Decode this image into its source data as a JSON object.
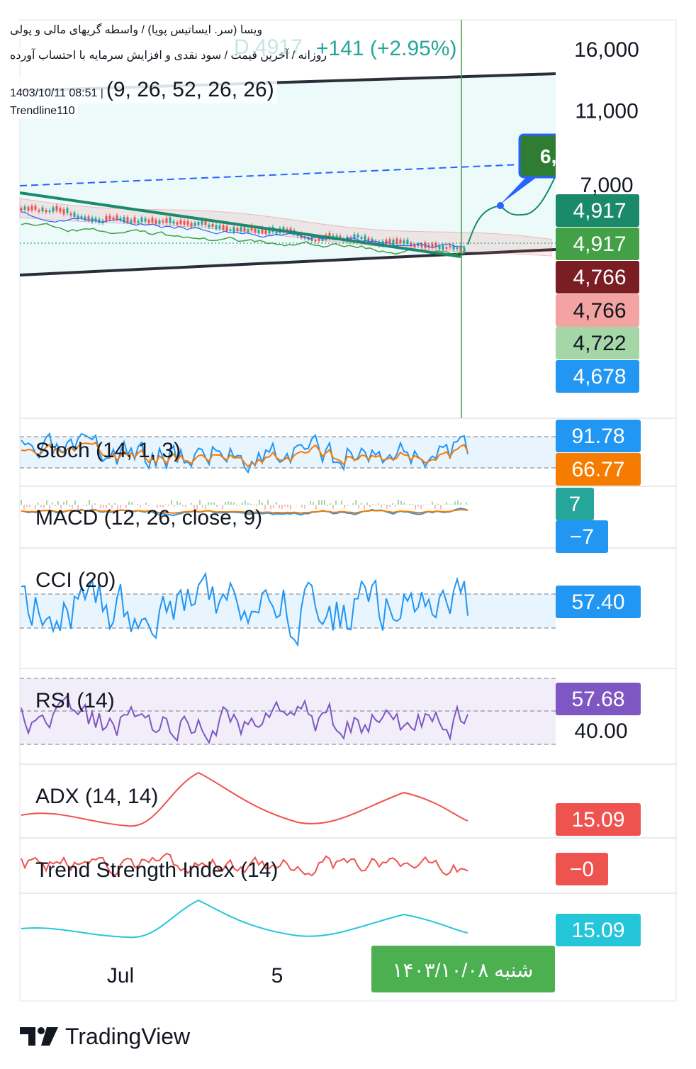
{
  "header": {
    "line1": "ویسا (سر. ایساتیس پویا) / واسطه گریهای مالی و پولی",
    "line2": "روزانه / آخرین قیمت / سود نقدی و افزایش سرمایه با احتساب آورده",
    "change": "+141 (+2.95%)",
    "ghost_price": "D 4917",
    "timestamp": "1403/10/11 08:51",
    "indicator_params": "(9, 26, 52, 26, 26)",
    "author": "Trendline110"
  },
  "colors": {
    "bull": "#26a69a",
    "bear": "#ef5350",
    "blue": "#2962ff",
    "orange": "#f57c00",
    "purple": "#7e57c2",
    "cyan": "#26c6da",
    "trend_green": "#1b8a6b",
    "date_badge": "#4caf50"
  },
  "chart_data": [
    {
      "type": "line",
      "panel": "price",
      "scale": "log",
      "y_ticks": [
        "16,000",
        "11,000",
        "7,000"
      ],
      "y_tick_values": [
        16000,
        11000,
        7000
      ],
      "x_ticks": [
        "Jul",
        "5"
      ],
      "last_price": 4917,
      "callout_label": "6,",
      "price_labels": [
        {
          "value": "4,917",
          "color": "#1b8a6b"
        },
        {
          "value": "4,917",
          "color": "#43a047"
        },
        {
          "value": "4,766",
          "color": "#7b1e24"
        },
        {
          "value": "4,766",
          "color": "#f4a3a3"
        },
        {
          "value": "4,722",
          "color": "#a5d6a7"
        },
        {
          "value": "4,678",
          "color": "#2196f3"
        }
      ],
      "date_badge": "شنبه ۱۴۰۳/۱۰/۰۸"
    },
    {
      "type": "line",
      "panel": "stoch",
      "name": "Stoch (14, 1, 3)",
      "values": [
        {
          "value": "91.78",
          "color": "#2196f3"
        },
        {
          "value": "66.77",
          "color": "#f57c00"
        }
      ]
    },
    {
      "type": "line",
      "panel": "macd",
      "name": "MACD (12, 26, close, 9)",
      "values": [
        {
          "value": "7",
          "color": "#26a69a"
        },
        {
          "value": "−7",
          "color": "#2196f3"
        }
      ]
    },
    {
      "type": "line",
      "panel": "cci",
      "name": "CCI (20)",
      "values": [
        {
          "value": "57.40",
          "color": "#2196f3"
        }
      ]
    },
    {
      "type": "line",
      "panel": "rsi",
      "name": "RSI (14)",
      "y_tick": "40.00",
      "values": [
        {
          "value": "57.68",
          "color": "#7e57c2"
        }
      ]
    },
    {
      "type": "line",
      "panel": "adx",
      "name": "ADX (14, 14)",
      "values": [
        {
          "value": "15.09",
          "color": "#ef5350"
        }
      ]
    },
    {
      "type": "line",
      "panel": "tsi",
      "name": "Trend Strength Index (14)",
      "values": [
        {
          "value": "−0",
          "color": "#ef5350"
        }
      ]
    },
    {
      "type": "line",
      "panel": "adx2",
      "name": "",
      "values": [
        {
          "value": "15.09",
          "color": "#26c6da"
        }
      ]
    }
  ],
  "brand": {
    "name": "TradingView"
  }
}
